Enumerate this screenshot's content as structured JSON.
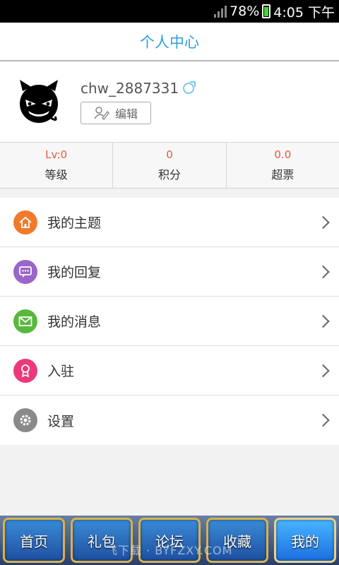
{
  "status_bar": {
    "battery_percent": "78%",
    "time": "4:05 下午"
  },
  "header": {
    "title": "个人中心"
  },
  "profile": {
    "username": "chw_2887331",
    "edit_label": "编辑"
  },
  "stats": [
    {
      "value": "Lv:0",
      "label": "等级"
    },
    {
      "value": "0",
      "label": "积分"
    },
    {
      "value": "0.0",
      "label": "超票"
    }
  ],
  "menu": [
    {
      "label": "我的主题",
      "icon": "home-icon",
      "color": "#f07a2c"
    },
    {
      "label": "我的回复",
      "icon": "chat-icon",
      "color": "#9a66c8"
    },
    {
      "label": "我的消息",
      "icon": "mail-icon",
      "color": "#58b83d"
    },
    {
      "label": "入驻",
      "icon": "badge-icon",
      "color": "#ea3a7c"
    },
    {
      "label": "设置",
      "icon": "gear-icon",
      "color": "#8a8a8a"
    }
  ],
  "tabbar": {
    "tabs": [
      "首页",
      "礼包",
      "论坛",
      "收藏",
      "我的"
    ],
    "active": "我的"
  },
  "watermark": "飞下载 · BYFZXY.COM"
}
